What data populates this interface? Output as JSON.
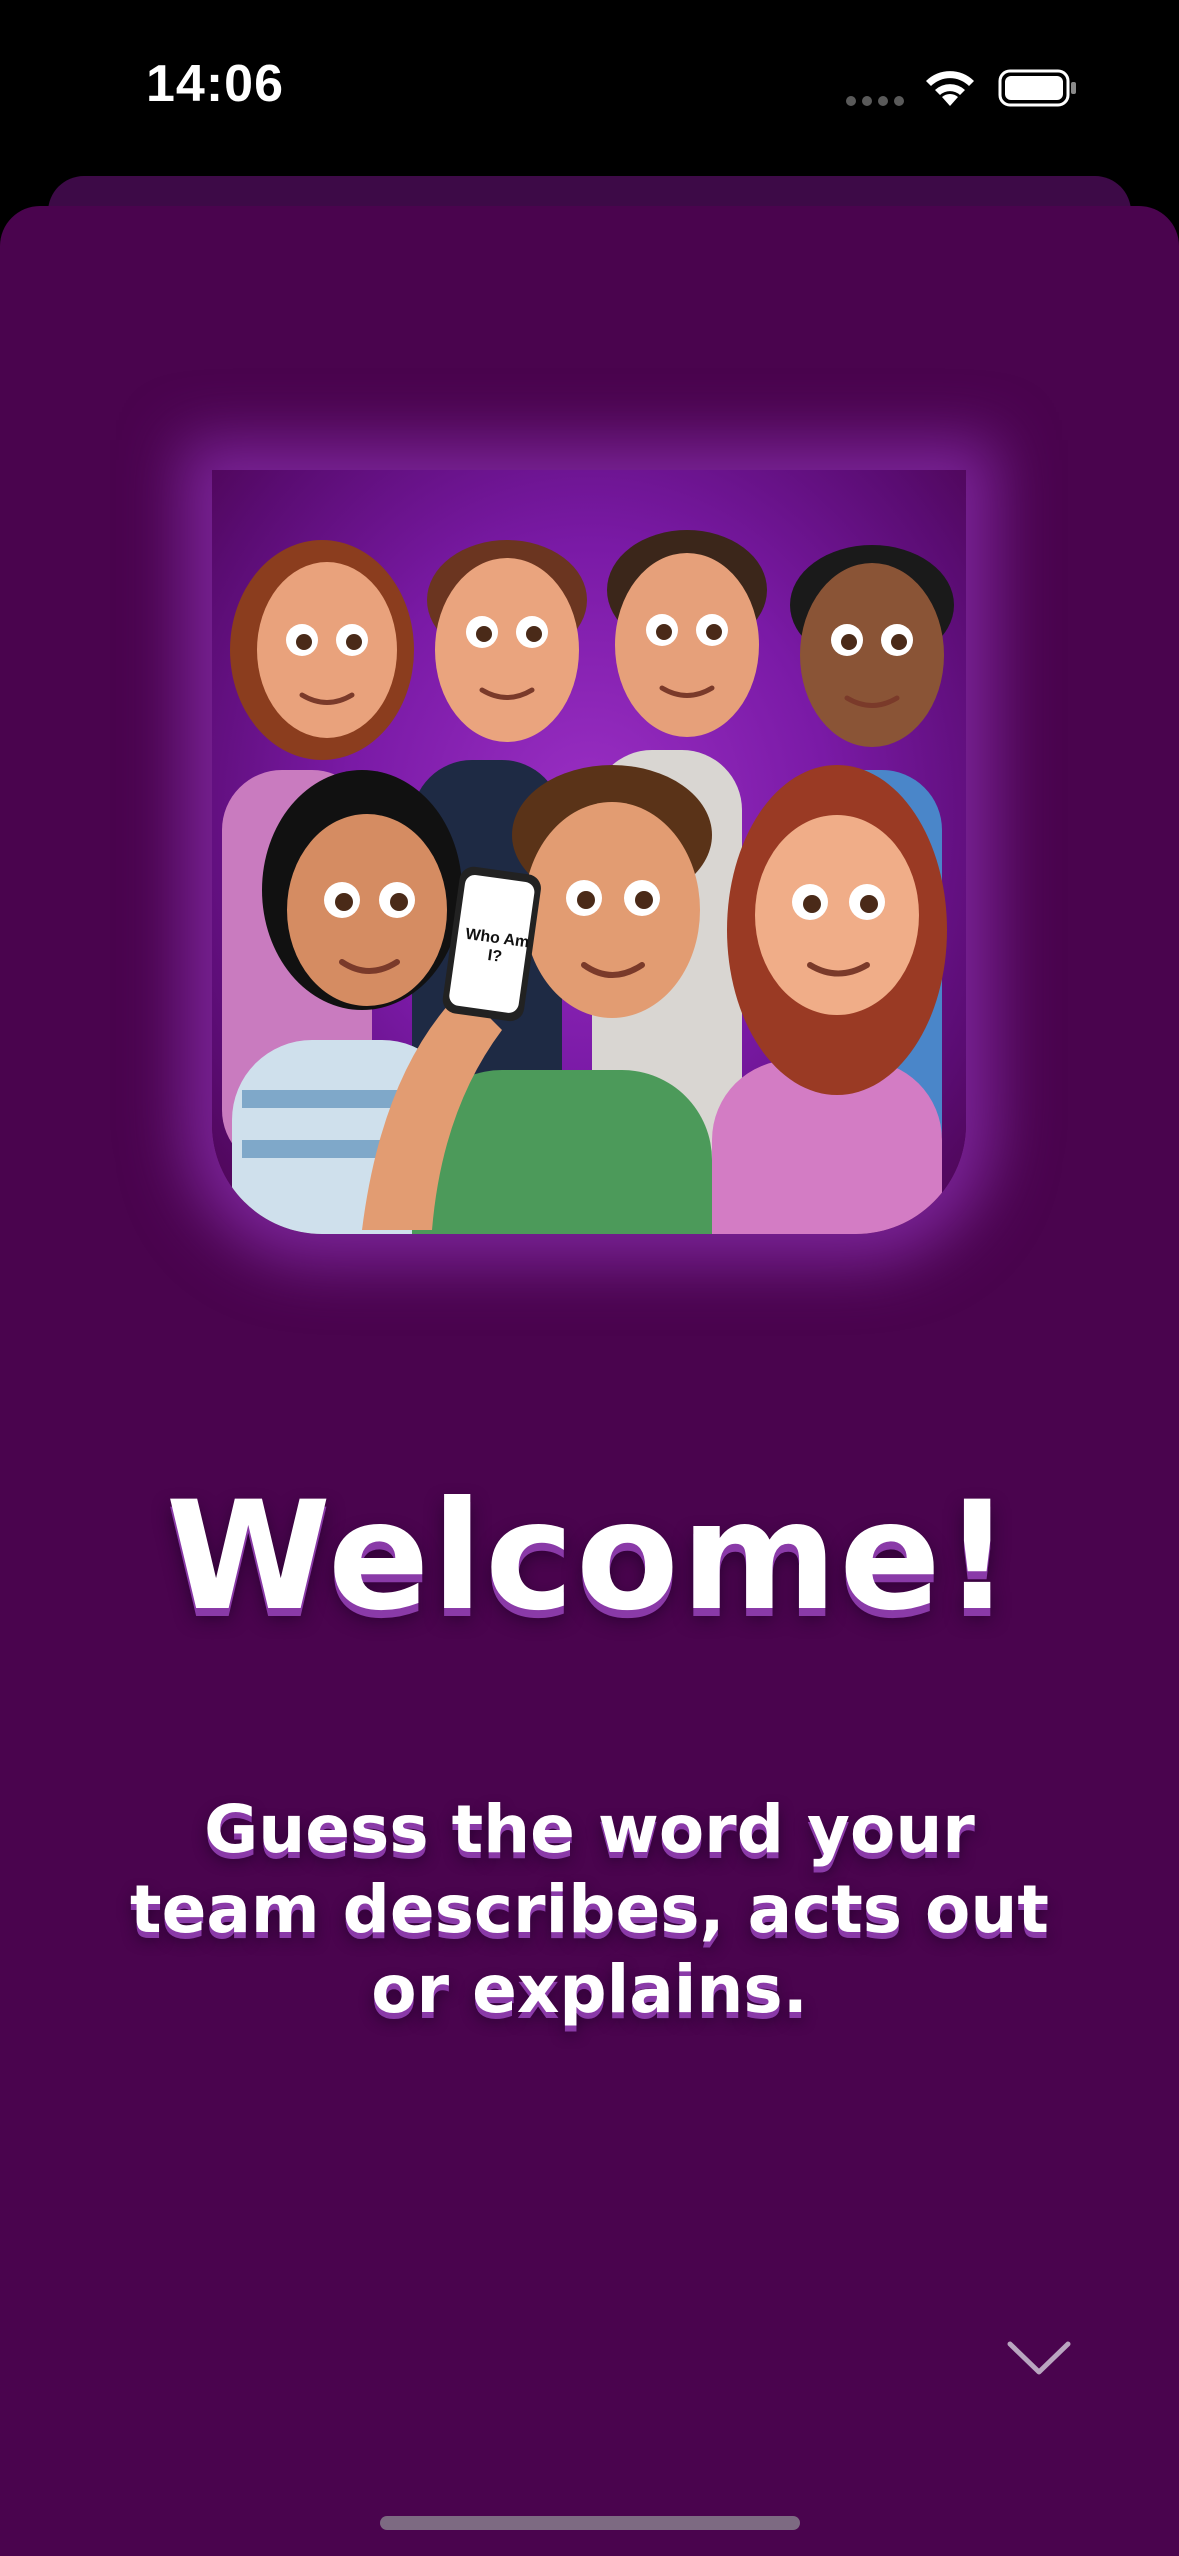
{
  "status_bar": {
    "time": "14:06",
    "icons": [
      "cellular-signal-icon",
      "wifi-icon",
      "battery-icon"
    ]
  },
  "hero": {
    "phone_label": "Who Am I?"
  },
  "content": {
    "title": "Welcome!",
    "subtitle": "Guess the word your team describes, acts out or explains."
  },
  "navigation": {
    "next_icon": "chevron-down-icon"
  },
  "colors": {
    "background": "#4a044e",
    "text": "#ffffff",
    "text_shadow": "#8a3aa8"
  }
}
